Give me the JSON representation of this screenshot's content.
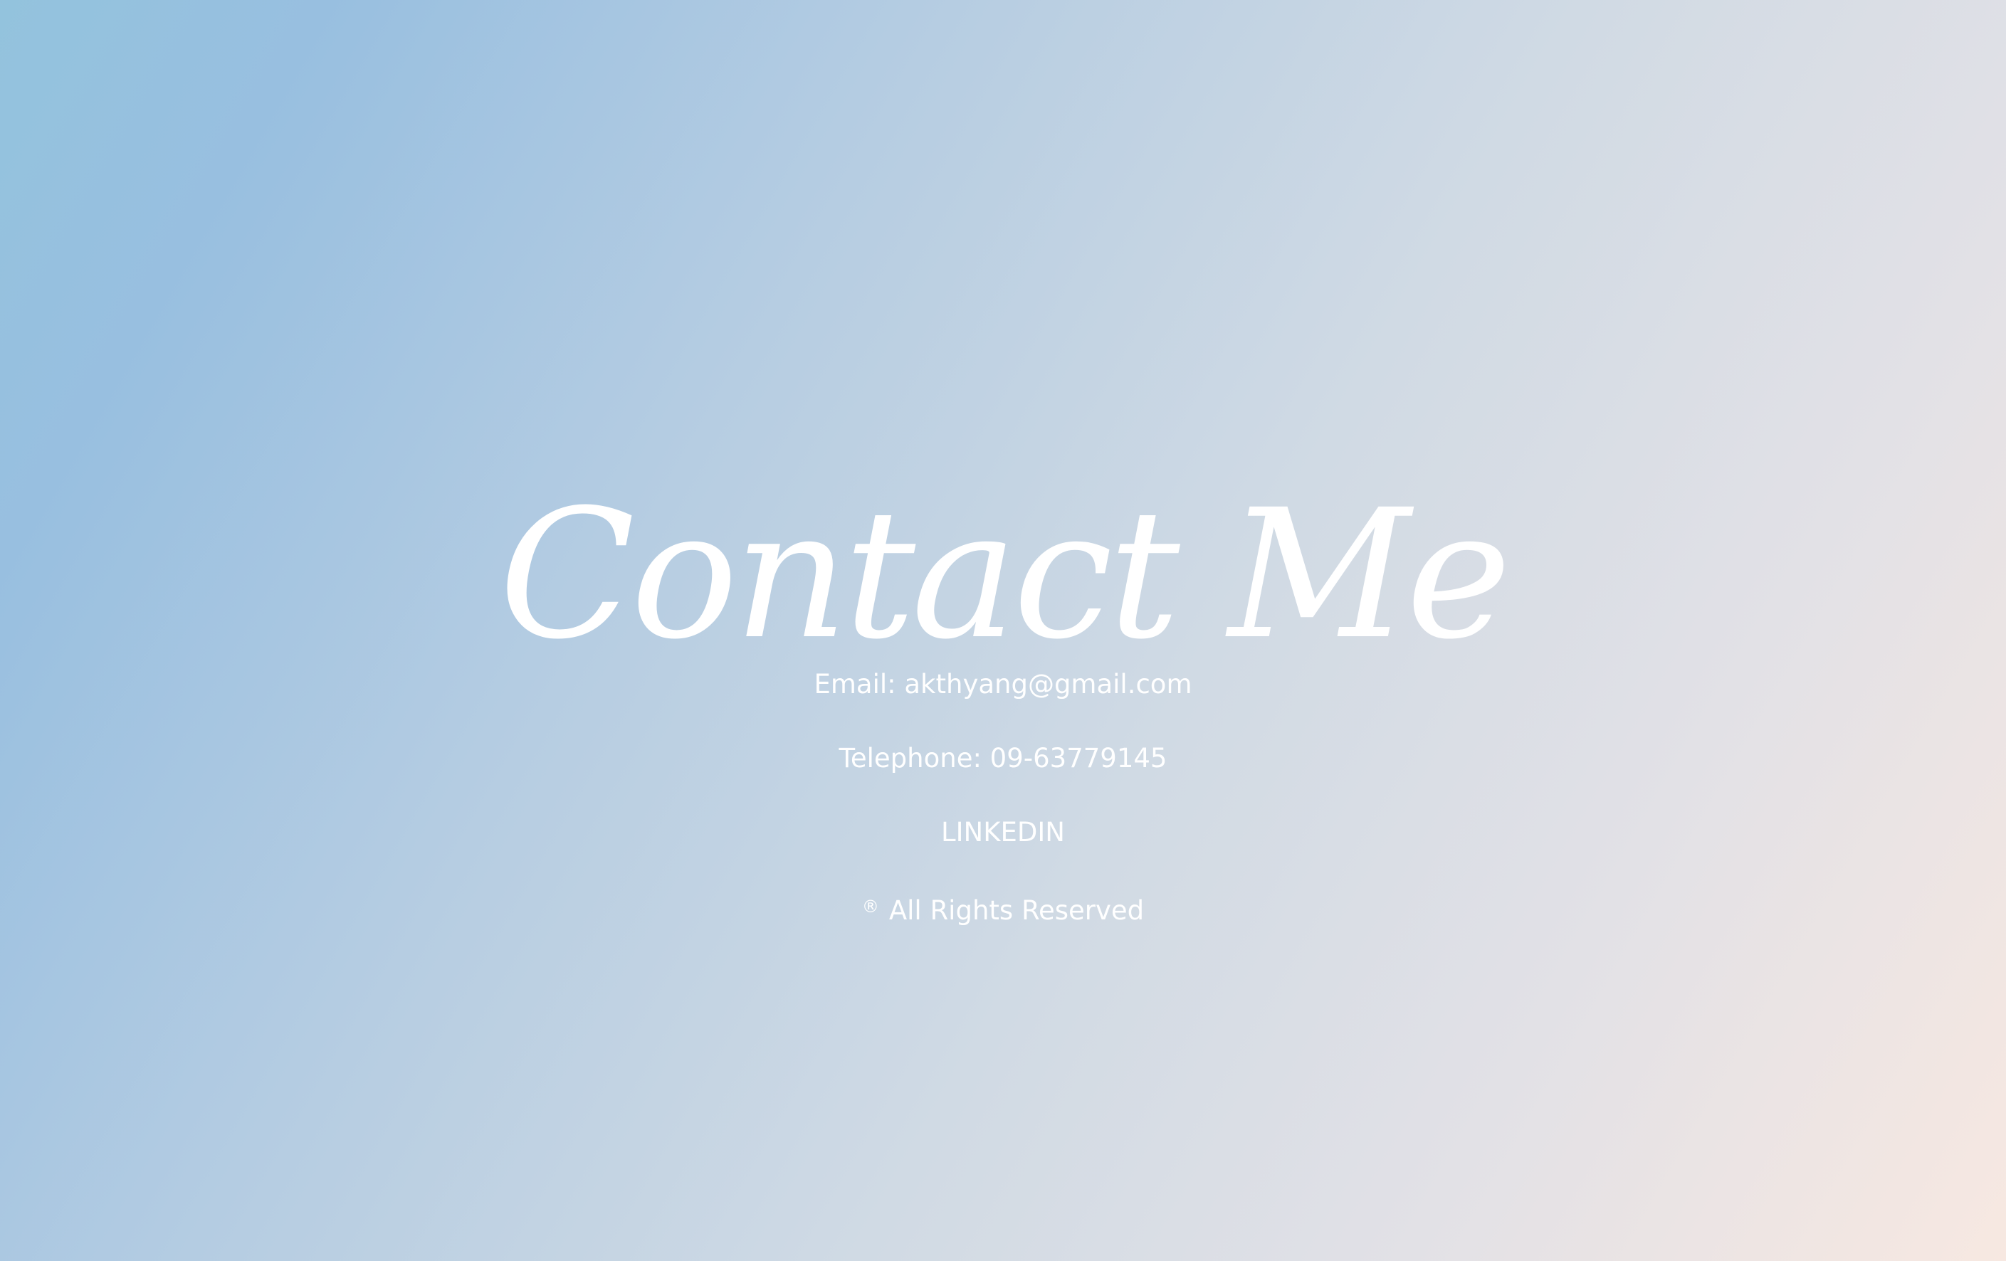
{
  "title": "Contact Me",
  "email_line": "Email: akthyang@gmail.com",
  "telephone_line": "Telephone: 09-63779145",
  "linkedin_label": "LINKEDIN",
  "reserved_symbol": "®",
  "rights_text": "All Rights Reserved",
  "colors": {
    "gradient_start": "#93c3dd",
    "gradient_end": "#f7e8e1",
    "text": "#ffffff"
  }
}
